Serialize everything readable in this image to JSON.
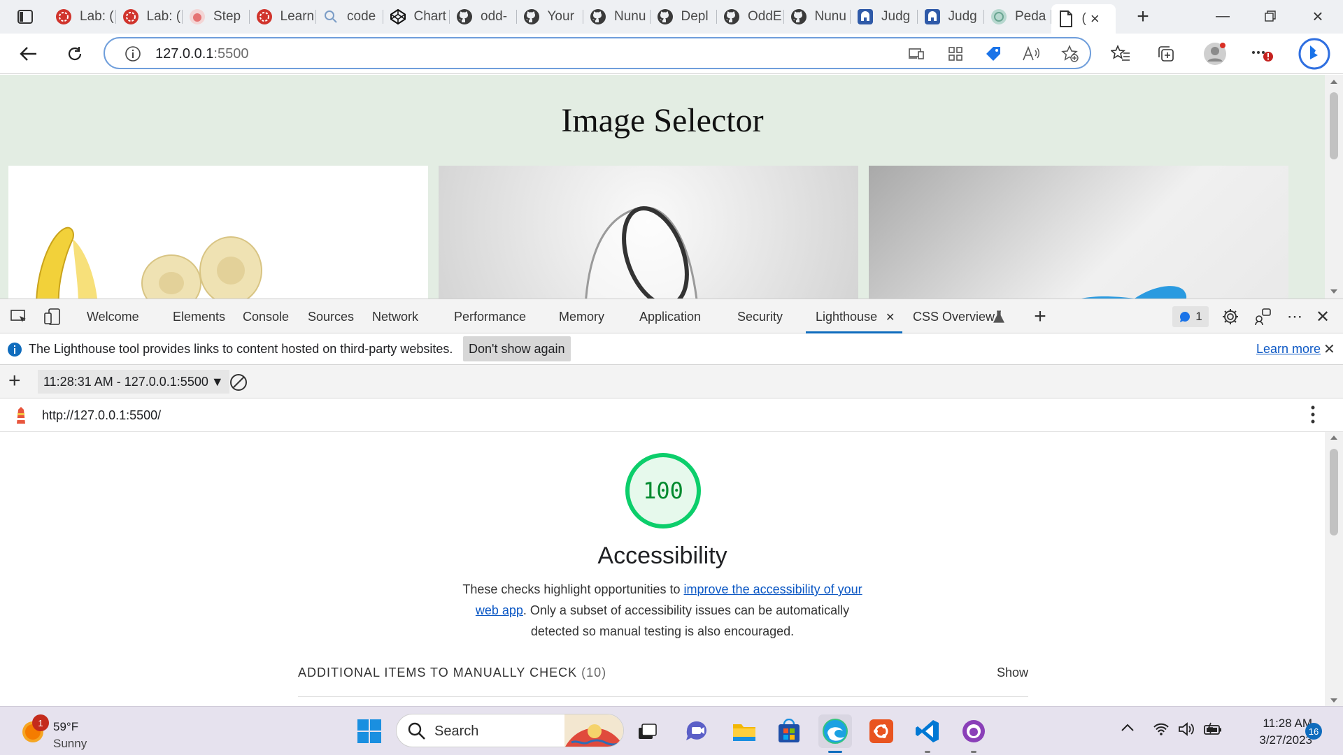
{
  "browser": {
    "tabs": [
      {
        "label": "Lab: (",
        "icon": "red-badge-icon"
      },
      {
        "label": "Lab: (",
        "icon": "red-badge-icon"
      },
      {
        "label": "Step",
        "icon": "pink-badge-icon"
      },
      {
        "label": "Learn",
        "icon": "red-badge-icon"
      },
      {
        "label": "code",
        "icon": "search-icon"
      },
      {
        "label": "Chart",
        "icon": "codepen-icon"
      },
      {
        "label": "odd-",
        "icon": "github-icon"
      },
      {
        "label": "Your",
        "icon": "github-icon"
      },
      {
        "label": "Nunu",
        "icon": "github-icon"
      },
      {
        "label": "Depl",
        "icon": "github-icon"
      },
      {
        "label": "OddE",
        "icon": "github-icon"
      },
      {
        "label": "Nunu",
        "icon": "github-icon"
      },
      {
        "label": "Judg",
        "icon": "helmet-icon"
      },
      {
        "label": "Judg",
        "icon": "helmet-icon"
      },
      {
        "label": "Peda",
        "icon": "openai-icon"
      },
      {
        "label": "(",
        "icon": "page-icon",
        "active": true
      }
    ],
    "address": {
      "host": "127.0.0.1",
      "port": ":5500"
    }
  },
  "page": {
    "title": "Image Selector"
  },
  "devtools": {
    "tabs": [
      "Welcome",
      "Elements",
      "Console",
      "Sources",
      "Network",
      "Performance",
      "Memory",
      "Application",
      "Security",
      "Lighthouse",
      "CSS Overview"
    ],
    "active_tab": "Lighthouse",
    "issues_count": "1",
    "info_message": "The Lighthouse tool provides links to content hosted on third-party websites.",
    "info_dismiss": "Don't show again",
    "info_learn": "Learn more",
    "report_selector": "11:28:31 AM - 127.0.0.1:5500",
    "report_url": "http://127.0.0.1:5500/"
  },
  "report": {
    "score": "100",
    "score_color": "#0cce6b",
    "category": "Accessibility",
    "desc_before": "These checks highlight opportunities to ",
    "desc_link": "improve the accessibility of your web app",
    "desc_after": ". Only a subset of accessibility issues can be automatically detected so manual testing is also encouraged.",
    "manual_label": "ADDITIONAL ITEMS TO MANUALLY CHECK",
    "manual_count": "(10)",
    "show_label": "Show"
  },
  "taskbar": {
    "weather_temp": "59°F",
    "weather_desc": "Sunny",
    "weather_badge": "1",
    "search_placeholder": "Search",
    "time": "11:28 AM",
    "date": "3/27/2023",
    "notif_count": "16"
  }
}
